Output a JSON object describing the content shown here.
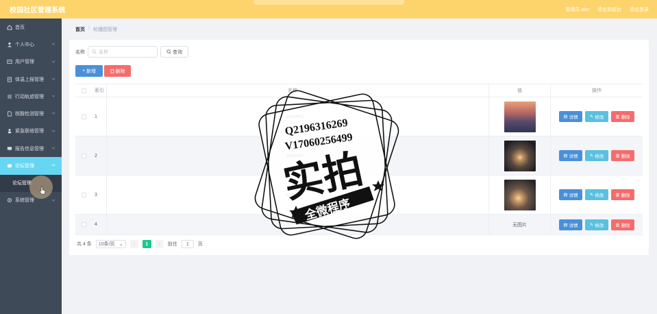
{
  "header": {
    "app_title": "校园社区管理系统",
    "admin_label": "管理员 abo",
    "front_link": "退出到前台",
    "logout_link": "退出登录"
  },
  "sidebar": {
    "items": [
      {
        "label": "首页",
        "icon": "home-icon"
      },
      {
        "label": "个人中心",
        "icon": "user-icon"
      },
      {
        "label": "用户管理",
        "icon": "id-card-icon"
      },
      {
        "label": "体温上报管理",
        "icon": "clipboard-icon"
      },
      {
        "label": "行动轨迹管理",
        "icon": "list-icon"
      },
      {
        "label": "核酸检测管理",
        "icon": "document-icon"
      },
      {
        "label": "紧急联络管理",
        "icon": "person-icon"
      },
      {
        "label": "报告信息管理",
        "icon": "monitor-icon"
      },
      {
        "label": "论坛管理",
        "icon": "chat-icon"
      },
      {
        "label": "系统管理",
        "icon": "settings-icon"
      }
    ],
    "submenu": {
      "label": "论坛管理"
    }
  },
  "breadcrumb": {
    "home": "首页",
    "separator": "/",
    "current": "轮播图管理"
  },
  "search": {
    "label": "名称",
    "placeholder": "名称",
    "query_button": "查询"
  },
  "actions": {
    "add_button": "新增",
    "delete_button": "删除"
  },
  "table": {
    "columns": {
      "index": "索引",
      "name": "名称",
      "value": "值",
      "operation": "操作"
    },
    "rows": [
      {
        "index": "1",
        "name": "picture1",
        "value": "image"
      },
      {
        "index": "2",
        "name": "picture2",
        "value": "image"
      },
      {
        "index": "3",
        "name": "picture3",
        "value": "image"
      },
      {
        "index": "4",
        "name": "homepage",
        "value": "无图片"
      }
    ],
    "row_buttons": {
      "detail": "详情",
      "edit": "修改",
      "delete": "删除"
    }
  },
  "pagination": {
    "total": "共 4 条",
    "page_size": "10条/页",
    "current_page": "1",
    "goto_prefix": "前往",
    "goto_value": "1",
    "goto_suffix": "页"
  },
  "watermark": {
    "line1": "Q2196316269",
    "line2": "V17060256499",
    "big": "实拍",
    "banner": "全微程序"
  },
  "colors": {
    "header": "#fdd46b",
    "sidebar": "#3f4a59",
    "sidebar_active": "#67d6f2",
    "primary": "#4a90d9",
    "info": "#5bc0de",
    "danger": "#f56c6c",
    "pager_active": "#1ac98e"
  }
}
